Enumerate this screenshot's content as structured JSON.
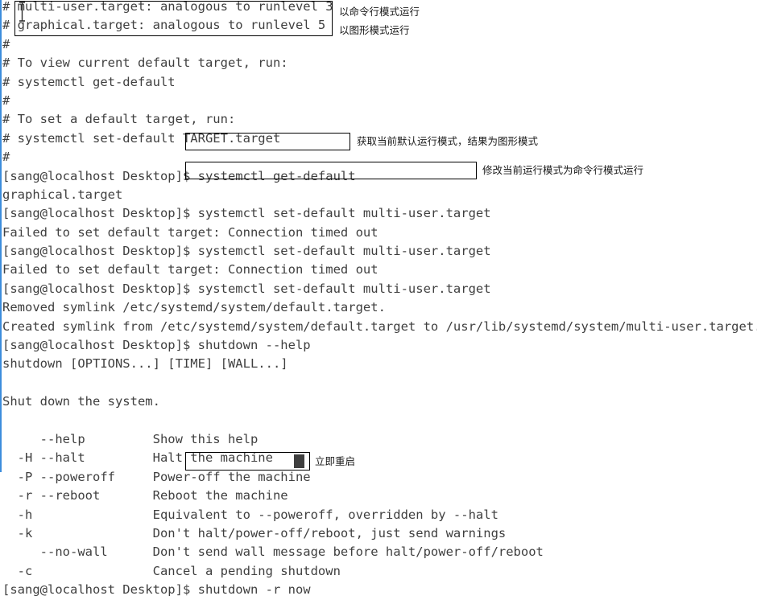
{
  "terminal": {
    "prompt": "[sang@localhost Desktop]$ ",
    "text_color": "#3f3f3f",
    "background_color": "#ffffff",
    "lines": [
      "#",
      "# multi-user.target: analogous to runlevel 3",
      "# graphical.target: analogous to runlevel 5",
      "#",
      "# To view current default target, run:",
      "# systemctl get-default",
      "#",
      "# To set a default target, run:",
      "# systemctl set-default TARGET.target",
      "#",
      "[sang@localhost Desktop]$ systemctl get-default",
      "graphical.target",
      "[sang@localhost Desktop]$ systemctl set-default multi-user.target",
      "Failed to set default target: Connection timed out",
      "[sang@localhost Desktop]$ systemctl set-default multi-user.target",
      "Failed to set default target: Connection timed out",
      "[sang@localhost Desktop]$ systemctl set-default multi-user.target",
      "Removed symlink /etc/systemd/system/default.target.",
      "Created symlink from /etc/systemd/system/default.target to /usr/lib/systemd/system/multi-user.target.",
      "[sang@localhost Desktop]$ shutdown --help",
      "shutdown [OPTIONS...] [TIME] [WALL...]",
      "",
      "Shut down the system.",
      "",
      "     --help         Show this help",
      "  -H --halt         Halt the machine",
      "  -P --poweroff     Power-off the machine",
      "  -r --reboot       Reboot the machine",
      "  -h                Equivalent to --poweroff, overridden by --halt",
      "  -k                Don't halt/power-off/reboot, just send warnings",
      "     --no-wall      Don't send wall message before halt/power-off/reboot",
      "  -c                Cancel a pending shutdown",
      "[sang@localhost Desktop]$ shutdown -r now"
    ]
  },
  "annotations": {
    "box_border_color": "#000000",
    "label_color": "#1a1a1a",
    "items": [
      {
        "id": "multi-user-graphical-box",
        "boxed_text": "multi-user.target: analogous to runlevel 3 / graphical.target: analogous to runlevel 5",
        "labels": [
          "以命令行模式运行",
          "以图形模式运行"
        ]
      },
      {
        "id": "get-default-box",
        "boxed_text": "systemctl get-default",
        "label": "获取当前默认运行模式，结果为图形模式"
      },
      {
        "id": "set-default-box",
        "boxed_text": "systemctl set-default multi-user.target",
        "label": "修改当前运行模式为命令行模式运行"
      },
      {
        "id": "shutdown-reboot-box",
        "boxed_text": "shutdown -r now",
        "label": "立即重启"
      }
    ]
  },
  "cursor": {
    "type": "block-cursor",
    "color": "#3f3f3f"
  }
}
